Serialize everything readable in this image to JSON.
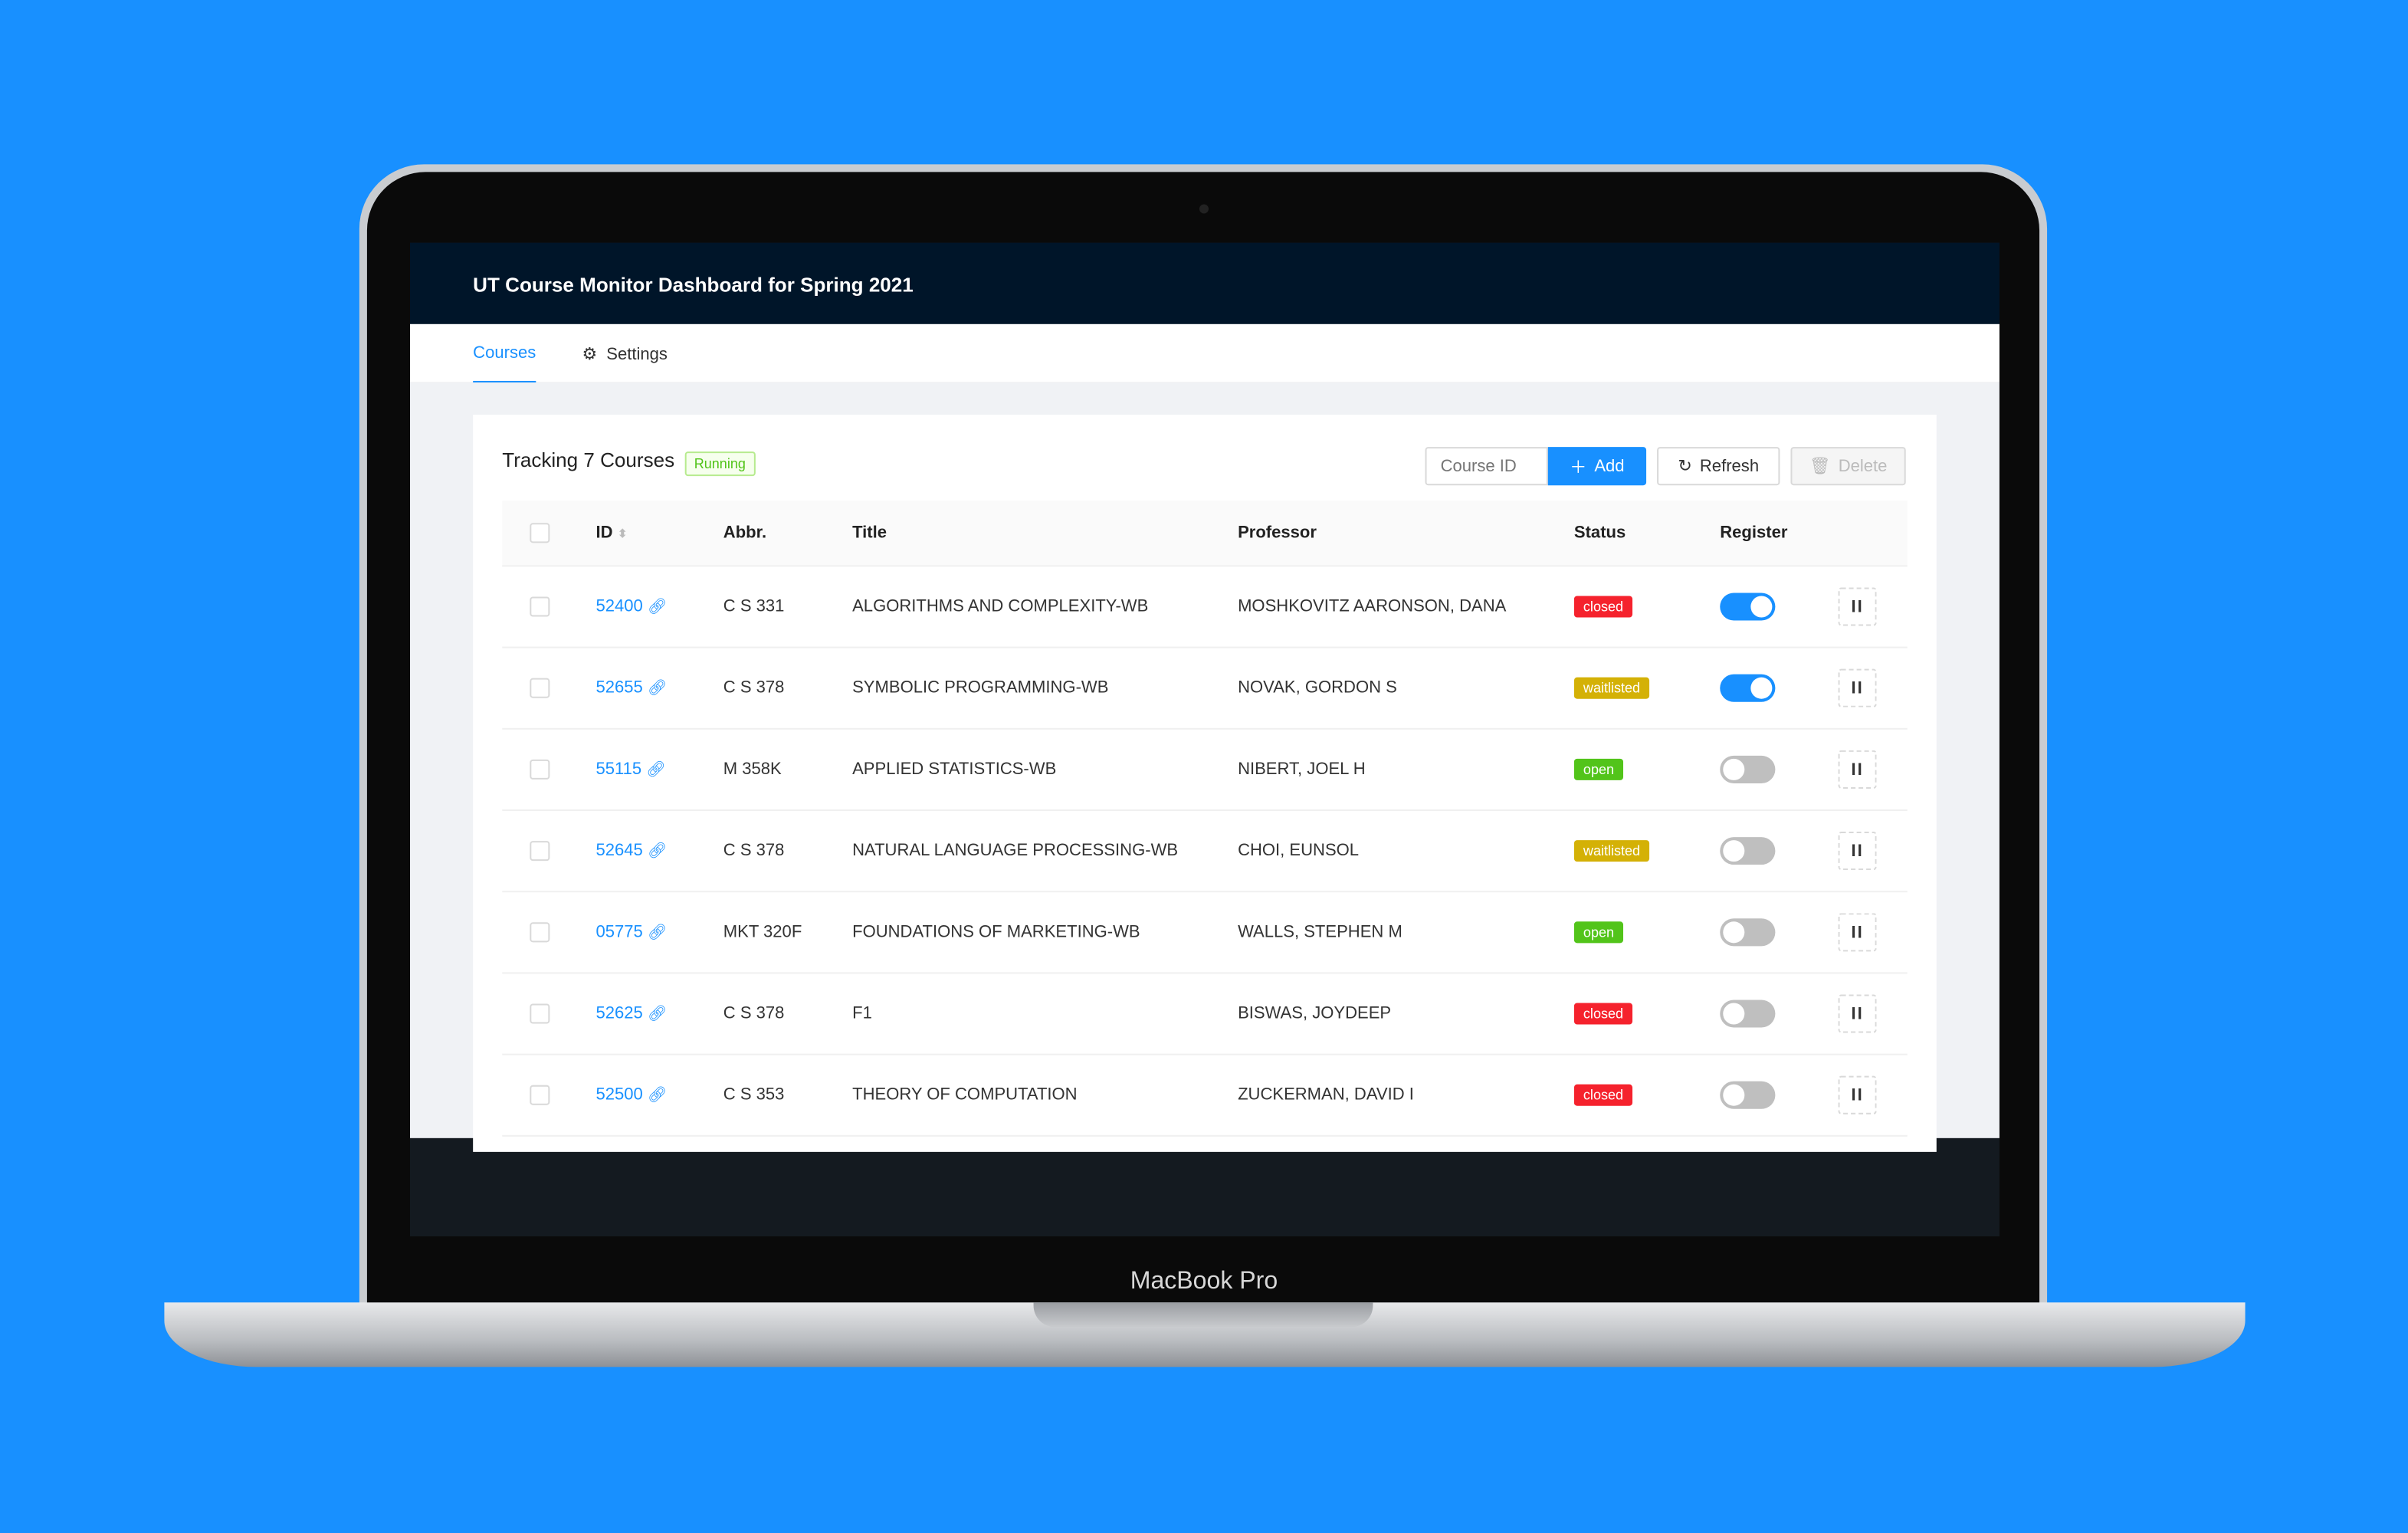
{
  "app": {
    "title": "UT Course Monitor Dashboard for Spring 2021"
  },
  "device": {
    "label": "MacBook Pro"
  },
  "tabs": [
    {
      "label": "Courses",
      "active": true
    },
    {
      "label": "Settings",
      "icon": "gear-icon"
    }
  ],
  "panel": {
    "title": "Tracking 7 Courses",
    "status": "Running"
  },
  "toolbar": {
    "input_placeholder": "Course ID",
    "input_value": "",
    "add": "Add",
    "refresh": "Refresh",
    "delete": "Delete"
  },
  "table": {
    "columns": [
      "ID",
      "Abbr.",
      "Title",
      "Professor",
      "Status",
      "Register"
    ],
    "rows": [
      {
        "id": "52400",
        "abbr": "C S 331",
        "title": "ALGORITHMS AND COMPLEXITY-WB",
        "professor": "MOSHKOVITZ AARONSON, DANA",
        "status": "closed",
        "register": true
      },
      {
        "id": "52655",
        "abbr": "C S 378",
        "title": "SYMBOLIC PROGRAMMING-WB",
        "professor": "NOVAK, GORDON S",
        "status": "waitlisted",
        "register": true
      },
      {
        "id": "55115",
        "abbr": "M 358K",
        "title": "APPLIED STATISTICS-WB",
        "professor": "NIBERT, JOEL H",
        "status": "open",
        "register": false
      },
      {
        "id": "52645",
        "abbr": "C S 378",
        "title": "NATURAL LANGUAGE PROCESSING-WB",
        "professor": "CHOI, EUNSOL",
        "status": "waitlisted",
        "register": false
      },
      {
        "id": "05775",
        "abbr": "MKT 320F",
        "title": "FOUNDATIONS OF MARKETING-WB",
        "professor": "WALLS, STEPHEN M",
        "status": "open",
        "register": false
      },
      {
        "id": "52625",
        "abbr": "C S 378",
        "title": "F1",
        "professor": "BISWAS, JOYDEEP",
        "status": "closed",
        "register": false
      },
      {
        "id": "52500",
        "abbr": "C S 353",
        "title": "THEORY OF COMPUTATION",
        "professor": "ZUCKERMAN, DAVID I",
        "status": "closed",
        "register": false
      }
    ]
  },
  "colors": {
    "accent": "#1890ff",
    "header": "#001529",
    "closed": "#f5222d",
    "waitlisted": "#d4b106",
    "open": "#52c41a",
    "background": "#1890ff"
  }
}
